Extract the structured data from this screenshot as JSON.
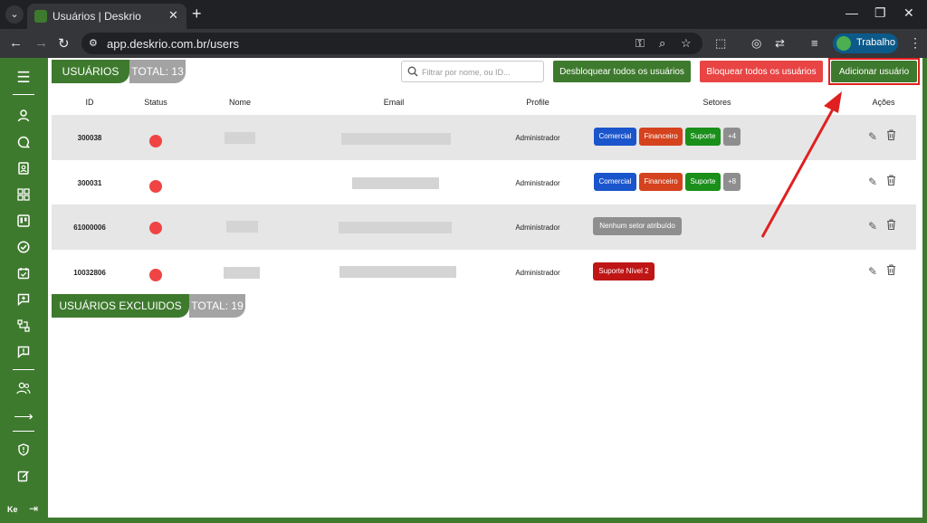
{
  "browser": {
    "tab_menu_icon": "chevron-down-icon",
    "tab_title": "Usuários | Deskrio",
    "tab_close": "✕",
    "new_tab": "+",
    "win_min": "—",
    "win_restore": "❐",
    "win_close": "✕",
    "back": "←",
    "forward": "→",
    "reload": "↻",
    "url": "app.deskrio.com.br/users",
    "profile_name": "Trabalho",
    "kebab": "⋮"
  },
  "colors": {
    "brand_green": "#3e7a2e",
    "danger_red": "#e94444",
    "total_gray": "#a3a3a3",
    "comercial_blue": "#1a55cc",
    "financeiro_red": "#d4421e",
    "suporte_green": "#1a8f1a",
    "suporte_n2_red": "#c01515"
  },
  "header": {
    "section_title": "USUÁRIOS",
    "total_label": "TOTAL: 13",
    "search_placeholder": "Filtrar por nome, ou ID...",
    "unlock_all": "Desbloquear todos os usuários",
    "block_all": "Bloquear todos os usuários",
    "add_user": "Adicionar usuário"
  },
  "table": {
    "columns": [
      "ID",
      "Status",
      "Nome",
      "Email",
      "Profile",
      "Setores",
      "Ações"
    ],
    "rows": [
      {
        "id": "300038",
        "profile": "Administrador",
        "tags": [
          "Comercial",
          "Financeiro",
          "Suporte",
          "+4"
        ]
      },
      {
        "id": "300031",
        "profile": "Administrador",
        "tags": [
          "Comercial",
          "Financeiro",
          "Suporte",
          "+8"
        ]
      },
      {
        "id": "61000006",
        "profile": "Administrador",
        "tags": [
          "Nenhum setor atribuído"
        ]
      },
      {
        "id": "10032806",
        "profile": "Administrador",
        "tags": [
          "Suporte Nível 2"
        ]
      }
    ]
  },
  "excluded": {
    "section_title": "USUÁRIOS EXCLUIDOS",
    "total_label": "TOTAL: 19"
  },
  "sidebar": {
    "user_initials": "Ke",
    "icons": [
      "menu-icon",
      "user-icon",
      "chat-icon",
      "contacts-icon",
      "dashboard-icon",
      "kanban-icon",
      "check-circle-icon",
      "calendar-check-icon",
      "message-plus-icon",
      "flow-icon",
      "alert-message-icon",
      "users-icon",
      "arrow-right-icon",
      "shield-icon",
      "edit-icon",
      "logout-icon"
    ]
  }
}
